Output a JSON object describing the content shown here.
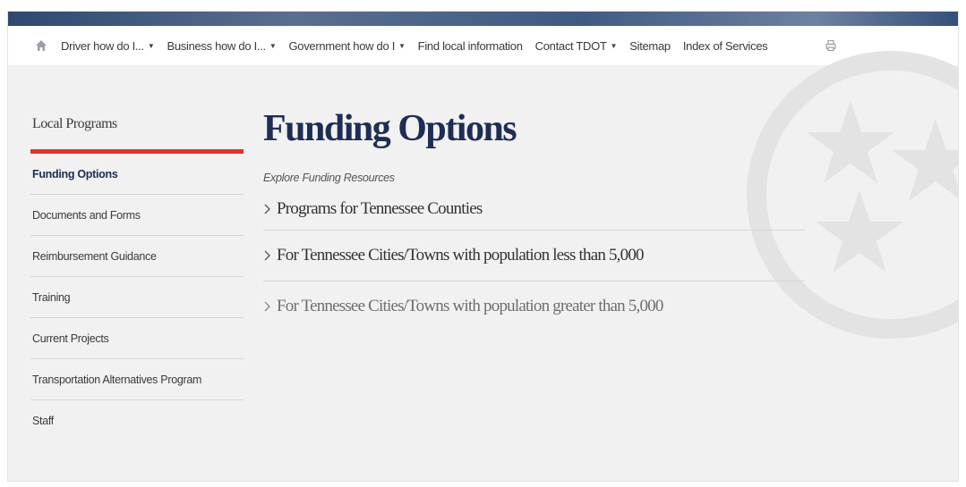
{
  "nav": {
    "items": [
      {
        "label": "Driver how do I...",
        "dropdown": true
      },
      {
        "label": "Business how do I...",
        "dropdown": true
      },
      {
        "label": "Government how do I",
        "dropdown": true
      },
      {
        "label": "Find local information",
        "dropdown": false
      },
      {
        "label": "Contact TDOT",
        "dropdown": true
      },
      {
        "label": "Sitemap",
        "dropdown": false
      },
      {
        "label": "Index of Services",
        "dropdown": false
      }
    ],
    "icons": {
      "home": "home-icon",
      "print": "print-icon"
    }
  },
  "sidebar": {
    "title": "Local Programs",
    "items": [
      {
        "label": "Funding Options"
      },
      {
        "label": "Documents and Forms"
      },
      {
        "label": "Reimbursement Guidance"
      },
      {
        "label": "Training"
      },
      {
        "label": "Current Projects"
      },
      {
        "label": "Transportation Alternatives Program"
      },
      {
        "label": "Staff"
      }
    ]
  },
  "main": {
    "title": "Funding Options",
    "subtitle": "Explore Funding Resources",
    "accordion": [
      {
        "label": "Programs for Tennessee Counties"
      },
      {
        "label": "For Tennessee Cities/Towns with population less than 5,000"
      },
      {
        "label": "For Tennessee Cities/Towns with population greater than 5,000"
      }
    ]
  },
  "colors": {
    "accent_red": "#e4312b",
    "title_navy": "#1e2d55",
    "band_blue": "#3f5a82",
    "background": "#f1f1f1"
  }
}
